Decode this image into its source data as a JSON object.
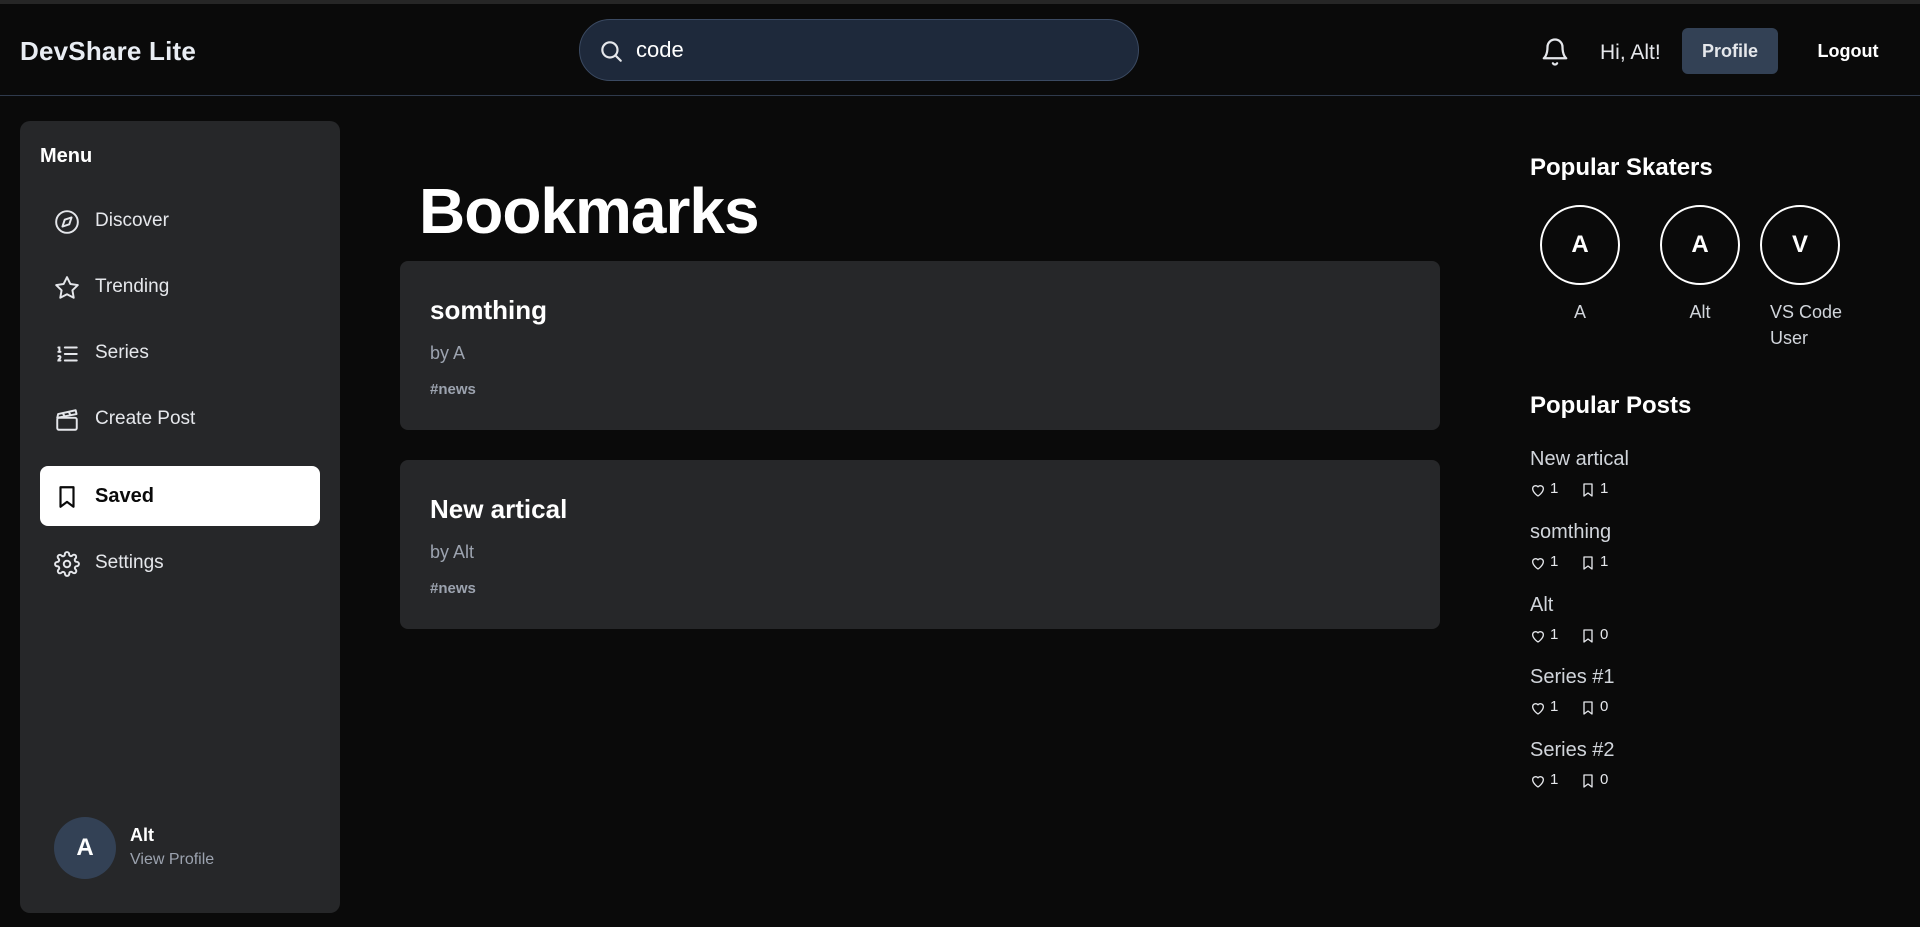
{
  "header": {
    "brand": "DevShare Lite",
    "search_value": "code",
    "greeting": "Hi, Alt!",
    "profile_label": "Profile",
    "logout_label": "Logout",
    "icons": {
      "search": "search-icon",
      "notifications": "bell-icon"
    }
  },
  "sidebar": {
    "menu_title": "Menu",
    "items": [
      {
        "label": "Discover",
        "icon": "compass-icon"
      },
      {
        "label": "Trending",
        "icon": "star-icon"
      },
      {
        "label": "Series",
        "icon": "list-icon"
      },
      {
        "label": "Create Post",
        "icon": "clapperboard-icon"
      },
      {
        "label": "Saved",
        "icon": "bookmark-icon",
        "active": true
      },
      {
        "label": "Settings",
        "icon": "gear-icon"
      }
    ],
    "user": {
      "initial": "A",
      "name": "Alt",
      "link": "View Profile"
    }
  },
  "main": {
    "title": "Bookmarks",
    "cards": [
      {
        "title": "somthing",
        "author": "by A",
        "tag": "#news"
      },
      {
        "title": "New artical",
        "author": "by Alt",
        "tag": "#news"
      }
    ]
  },
  "right": {
    "skaters_title": "Popular Skaters",
    "skaters": [
      {
        "initial": "A",
        "name": "A"
      },
      {
        "initial": "A",
        "name": "Alt"
      },
      {
        "initial": "V",
        "name": "VS Code User"
      }
    ],
    "posts_title": "Popular Posts",
    "posts": [
      {
        "title": "New artical",
        "likes": "1",
        "saves": "1"
      },
      {
        "title": "somthing",
        "likes": "1",
        "saves": "1"
      },
      {
        "title": "Alt",
        "likes": "1",
        "saves": "0"
      },
      {
        "title": "Series #1",
        "likes": "1",
        "saves": "0"
      },
      {
        "title": "Series #2",
        "likes": "1",
        "saves": "0"
      }
    ]
  },
  "colors": {
    "background": "#0a0a0a",
    "panel": "#262729",
    "search_bg": "#1e293b",
    "profile_button": "#334155",
    "active_nav": "#ffffff"
  }
}
